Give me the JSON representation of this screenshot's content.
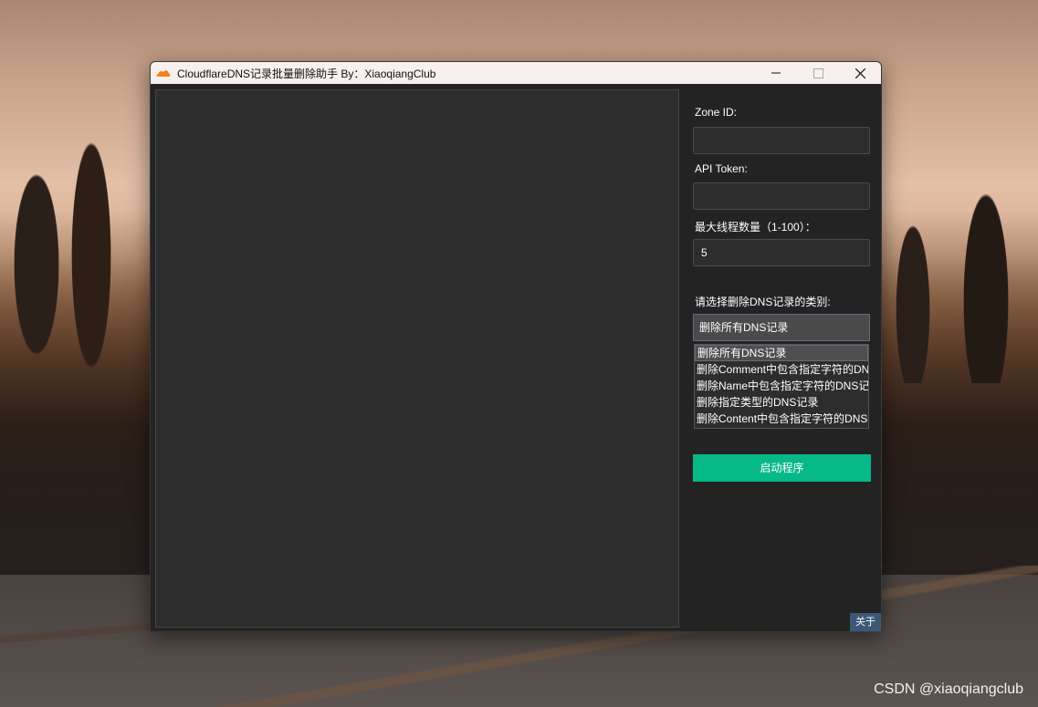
{
  "window": {
    "title": "CloudflareDNS记录批量删除助手   By：XiaoqiangClub",
    "app_icon": "cloudflare-cloud-icon",
    "accent_color": "#f48120"
  },
  "form": {
    "zone_id_label": "Zone ID:",
    "zone_id_value": "",
    "api_token_label": "API Token:",
    "api_token_value": "",
    "threads_label": "最大线程数量（1-100）：",
    "threads_value": "5",
    "category_label": "请选择删除DNS记录的类别:",
    "category_selected": "删除所有DNS记录",
    "category_options": [
      "删除所有DNS记录",
      "删除Comment中包含指定字符的DNS记录",
      "删除Name中包含指定字符的DNS记录",
      "删除指定类型的DNS记录",
      "删除Content中包含指定字符的DNS记录"
    ],
    "start_button": "启动程序",
    "start_button_color": "#07b889",
    "about_button": "关于"
  },
  "watermark": "CSDN @xiaoqiangclub"
}
